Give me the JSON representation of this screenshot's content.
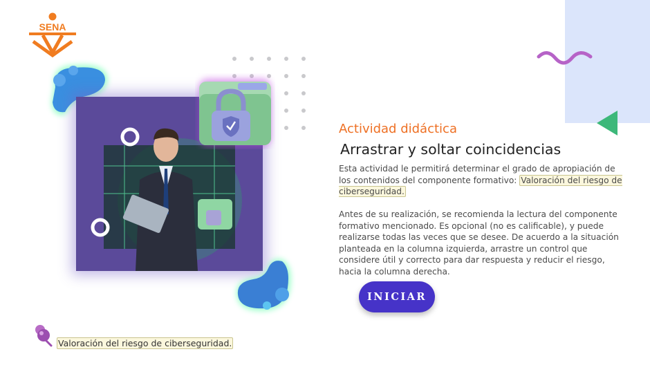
{
  "logo": {
    "text": "SENA",
    "color": "#f07c20"
  },
  "activity": {
    "kicker": "Actividad didáctica",
    "title": "Arrastrar y soltar coincidencias",
    "intro_before": "Esta actividad le permitirá determinar el grado de apropiación de los contenidos del componente formativo: ",
    "intro_highlight": "Valoración del riesgo de ciberseguridad.",
    "instructions": "Antes de su realización, se recomienda la lectura del componente formativo mencionado.  Es opcional (no es calificable), y puede realizarse todas las veces que se desee.  De acuerdo a la situación planteada en la columna izquierda, arrastre un control que considere útil y correcto para dar respuesta y reducir el riesgo, hacia la columna derecha."
  },
  "start_button": {
    "label": "INICIAR",
    "color": "#4633c8"
  },
  "footer": {
    "reference": "Valoración del riesgo de ciberseguridad."
  },
  "colors": {
    "accent_orange": "#ee7024",
    "panel_lavender": "#dbe5fb",
    "wave_purple": "#b663c7",
    "triangle_green": "#3db87a"
  },
  "icons": [
    "sena-logo",
    "lock-folder-icon",
    "pin-icon",
    "wave-decoration",
    "triangle-decoration"
  ]
}
